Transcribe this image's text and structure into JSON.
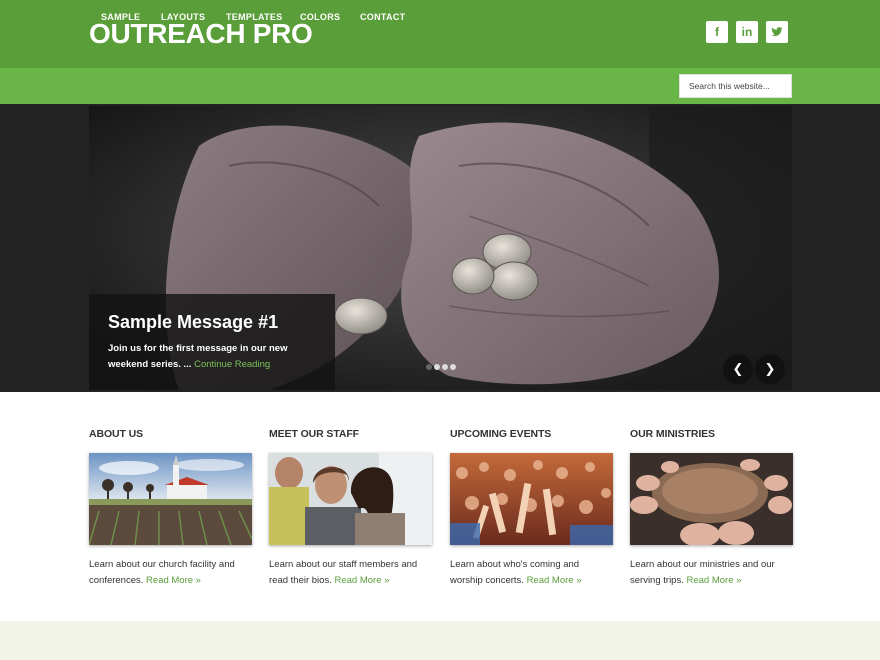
{
  "site": {
    "title": "OUTREACH PRO"
  },
  "social": [
    {
      "icon": "facebook-icon",
      "glyph": "f"
    },
    {
      "icon": "linkedin-icon",
      "glyph": "in"
    },
    {
      "icon": "twitter-icon",
      "glyph": ""
    }
  ],
  "nav": {
    "items": [
      "SAMPLE",
      "LAYOUTS",
      "TEMPLATES",
      "COLORS",
      "CONTACT"
    ]
  },
  "search": {
    "placeholder": "Search this website..."
  },
  "slider": {
    "title": "Sample Message #1",
    "text": "Join us for the first message in our new weekend series. ...",
    "link": "Continue Reading",
    "prev_glyph": "❮",
    "next_glyph": "❯",
    "slide_count": 4,
    "active_slide": 1
  },
  "columns": [
    {
      "title": "ABOUT US",
      "text": "Learn about our church facility and conferences.",
      "link": "Read More »"
    },
    {
      "title": "MEET OUR STAFF",
      "text": "Learn about our staff members and read their bios.",
      "link": "Read More »"
    },
    {
      "title": "UPCOMING EVENTS",
      "text": "Learn about who's coming and worship concerts.",
      "link": "Read More »"
    },
    {
      "title": "OUR MINISTRIES",
      "text": "Learn about our ministries and our serving trips.",
      "link": "Read More »"
    }
  ],
  "colors": {
    "header": "#5a9e3a",
    "nav": "#6ab547",
    "link": "#5a9e3a",
    "footer_band": "#f2f4ea"
  }
}
